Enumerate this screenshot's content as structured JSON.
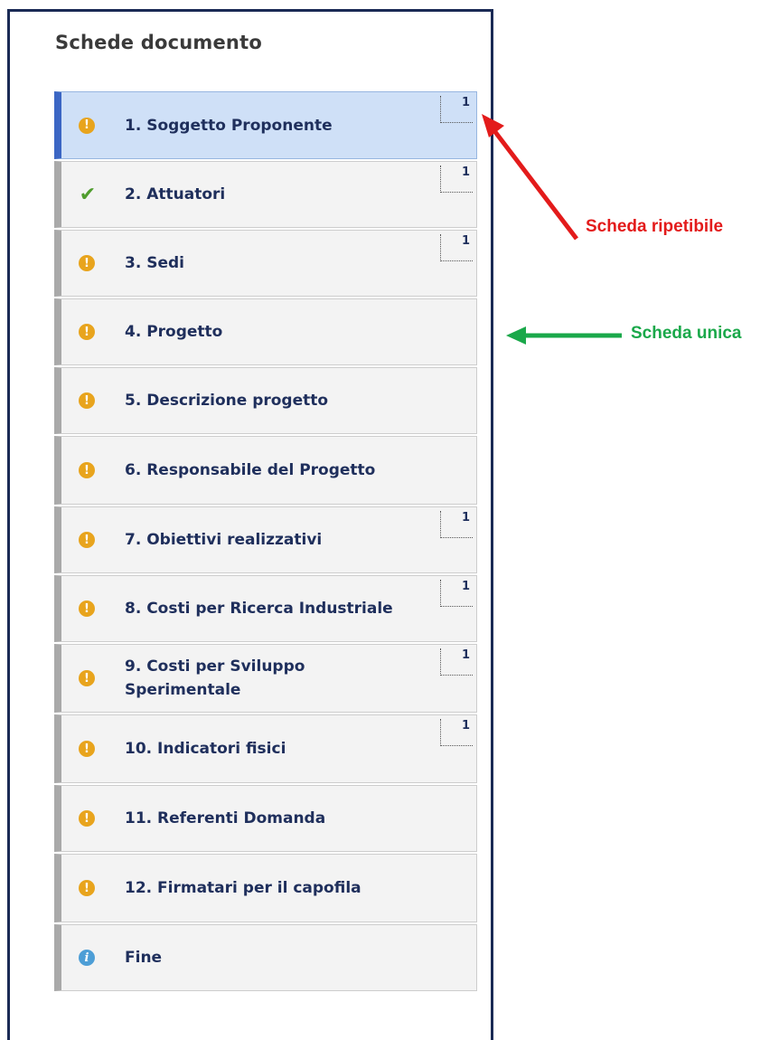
{
  "panel": {
    "title": "Schede documento"
  },
  "items": [
    {
      "label": "1. Soggetto Proponente",
      "status": "warning-icon",
      "badge": "1",
      "active": true
    },
    {
      "label": "2. Attuatori",
      "status": "checkmark-icon",
      "badge": "1",
      "active": false
    },
    {
      "label": "3. Sedi",
      "status": "warning-icon",
      "badge": "1",
      "active": false
    },
    {
      "label": "4. Progetto",
      "status": "warning-icon",
      "badge": "",
      "active": false
    },
    {
      "label": "5. Descrizione progetto",
      "status": "warning-icon",
      "badge": "",
      "active": false
    },
    {
      "label": "6. Responsabile del Progetto",
      "status": "warning-icon",
      "badge": "",
      "active": false
    },
    {
      "label": "7. Obiettivi realizzativi",
      "status": "warning-icon",
      "badge": "1",
      "active": false
    },
    {
      "label": "8. Costi per Ricerca Industriale",
      "status": "warning-icon",
      "badge": "1",
      "active": false
    },
    {
      "label": "9. Costi per Sviluppo Sperimentale",
      "status": "warning-icon",
      "badge": "1",
      "active": false
    },
    {
      "label": "10. Indicatori fisici",
      "status": "warning-icon",
      "badge": "1",
      "active": false
    },
    {
      "label": "11. Referenti Domanda",
      "status": "warning-icon",
      "badge": "",
      "active": false
    },
    {
      "label": "12. Firmatari per il capofila",
      "status": "warning-icon",
      "badge": "",
      "active": false
    },
    {
      "label": "Fine",
      "status": "info-icon",
      "badge": "",
      "active": false
    }
  ],
  "annotations": {
    "repeatable": "Scheda ripetibile",
    "unique": "Scheda unica"
  },
  "colors": {
    "active_accent": "#3b66c4",
    "warning": "#e8a41d",
    "ok": "#4f9d2d",
    "info": "#4d9ed6",
    "annotation_red": "#e31b1b",
    "annotation_green": "#1aa84a"
  }
}
